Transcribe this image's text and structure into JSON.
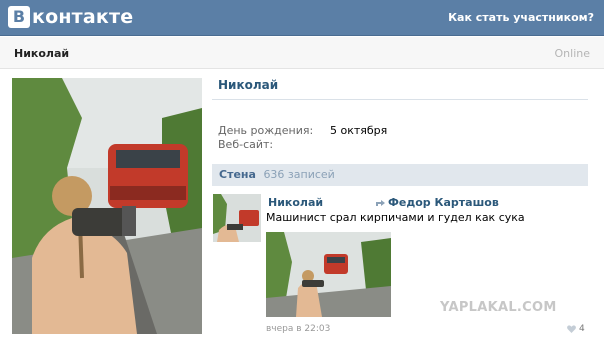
{
  "header": {
    "logo_letter": "В",
    "logo_text": "контакте",
    "join_link": "Как стать участником?",
    "bg_color": "#5b7fa6"
  },
  "namebar": {
    "name": "Николай",
    "status": "Online"
  },
  "profile": {
    "name": "Николай",
    "info": [
      {
        "label": "День рождения:",
        "value": "5 октября"
      },
      {
        "label": "Веб-сайт:",
        "value": ""
      }
    ]
  },
  "wall": {
    "title": "Стена",
    "count": "636 записей"
  },
  "post": {
    "author": "Николай",
    "target": "Федор Карташов",
    "text": "Машинист срал кирпичами и гудел как сука",
    "time": "вчера в 22:03",
    "likes": "4"
  },
  "watermark": "YAPLAKAL.COM",
  "icons": {
    "share": "share-arrow-icon",
    "like": "heart-icon"
  }
}
